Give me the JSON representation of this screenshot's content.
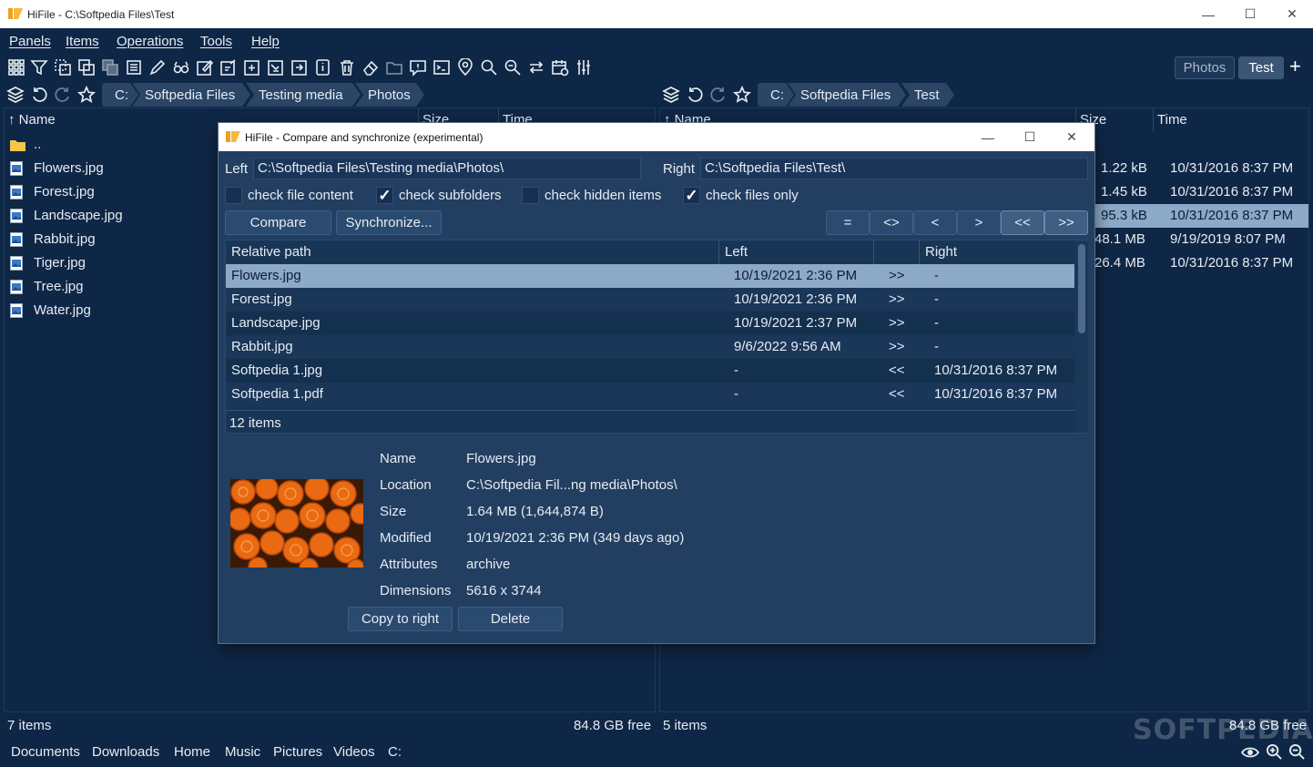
{
  "window": {
    "title": "HiFile - C:\\Softpedia Files\\Test"
  },
  "menu": [
    "Panels",
    "Items",
    "Operations",
    "Tools",
    "Help"
  ],
  "tabs": [
    "Photos",
    "Test"
  ],
  "left_panel": {
    "breadcrumb": [
      "C:",
      "Softpedia Files",
      "Testing media",
      "Photos"
    ],
    "columns": [
      "↑ Name",
      "Size",
      "Time"
    ],
    "files": [
      "..",
      "Flowers.jpg",
      "Forest.jpg",
      "Landscape.jpg",
      "Rabbit.jpg",
      "Tiger.jpg",
      "Tree.jpg",
      "Water.jpg"
    ],
    "status_items": "7 items",
    "status_free": "84.8 GB free"
  },
  "right_panel": {
    "breadcrumb": [
      "C:",
      "Softpedia Files",
      "Test"
    ],
    "columns": [
      "↑ Name",
      "Size",
      "Time"
    ],
    "rows": [
      {
        "size": "1.22 kB",
        "time": "10/31/2016 8:37 PM"
      },
      {
        "size": "1.45 kB",
        "time": "10/31/2016 8:37 PM"
      },
      {
        "size": "95.3 kB",
        "time": "10/31/2016 8:37 PM"
      },
      {
        "size": "48.1 MB",
        "time": "9/19/2019 8:07 PM"
      },
      {
        "size": "26.4 MB",
        "time": "10/31/2016 8:37 PM"
      }
    ],
    "status_items": "5 items",
    "status_free": "84.8 GB free"
  },
  "bookmarks": [
    "Documents",
    "Downloads",
    "Home",
    "Music",
    "Pictures",
    "Videos",
    "C:"
  ],
  "dialog": {
    "title": "HiFile - Compare and synchronize (experimental)",
    "left_label": "Left",
    "left_path": "C:\\Softpedia Files\\Testing media\\Photos\\",
    "right_label": "Right",
    "right_path": "C:\\Softpedia Files\\Test\\",
    "options": [
      {
        "label": "check file content",
        "checked": false
      },
      {
        "label": "check subfolders",
        "checked": true
      },
      {
        "label": "check hidden items",
        "checked": false
      },
      {
        "label": "check files only",
        "checked": true
      }
    ],
    "compare_label": "Compare",
    "sync_label": "Synchronize...",
    "filters": [
      "=",
      "<>",
      "<",
      ">",
      "<<",
      ">>"
    ],
    "grid_columns": [
      "Relative path",
      "Left",
      "Right"
    ],
    "rows": [
      {
        "path": "Flowers.jpg",
        "left": "10/19/2021 2:36 PM",
        "dir": ">>",
        "right": "-"
      },
      {
        "path": "Forest.jpg",
        "left": "10/19/2021 2:36 PM",
        "dir": ">>",
        "right": "-"
      },
      {
        "path": "Landscape.jpg",
        "left": "10/19/2021 2:37 PM",
        "dir": ">>",
        "right": "-"
      },
      {
        "path": "Rabbit.jpg",
        "left": "9/6/2022 9:56 AM",
        "dir": ">>",
        "right": "-"
      },
      {
        "path": "Softpedia 1.jpg",
        "left": "-",
        "dir": "<<",
        "right": "10/31/2016 8:37 PM"
      },
      {
        "path": "Softpedia 1.pdf",
        "left": "-",
        "dir": "<<",
        "right": "10/31/2016 8:37 PM"
      }
    ],
    "item_count": "12 items",
    "details": [
      {
        "label": "Name",
        "value": "Flowers.jpg"
      },
      {
        "label": "Location",
        "value": "C:\\Softpedia Fil...ng media\\Photos\\"
      },
      {
        "label": "Size",
        "value": "1.64 MB (1,644,874 B)"
      },
      {
        "label": "Modified",
        "value": "10/19/2021 2:36 PM (349 days ago)"
      },
      {
        "label": "Attributes",
        "value": "archive"
      },
      {
        "label": "Dimensions",
        "value": "5616 x 3744"
      }
    ],
    "copy_label": "Copy to right",
    "delete_label": "Delete"
  },
  "watermark": "SOFTPEDIA",
  "colors": {
    "bg": "#0f2746",
    "selection": "#8da9c8",
    "dialog": "#223f61"
  }
}
